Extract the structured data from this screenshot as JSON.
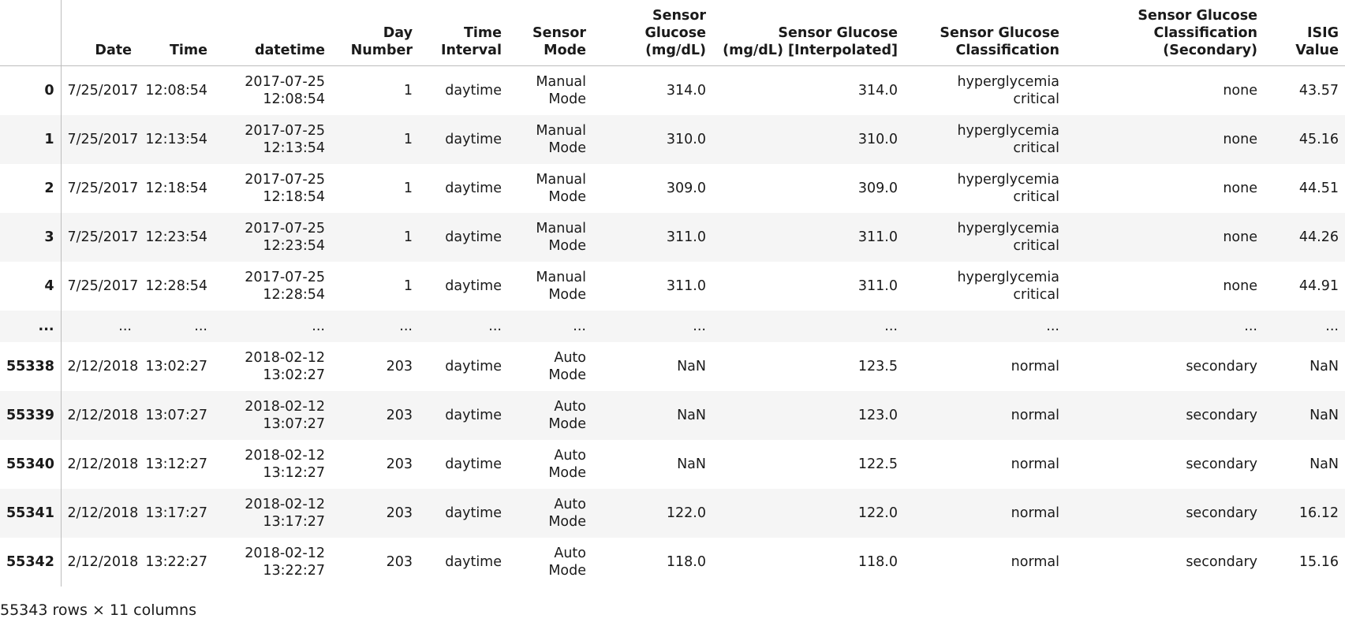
{
  "table": {
    "columns": [
      "Date",
      "Time",
      "datetime",
      "Day Number",
      "Time Interval",
      "Sensor Mode",
      "Sensor Glucose (mg/dL)",
      "Sensor Glucose (mg/dL) [Interpolated]",
      "Sensor Glucose Classification",
      "Sensor Glucose Classification (Secondary)",
      "ISIG Value"
    ],
    "rows": [
      {
        "index": "0",
        "cells": [
          "7/25/2017",
          "12:08:54",
          "2017-07-25 12:08:54",
          "1",
          "daytime",
          "Manual Mode",
          "314.0",
          "314.0",
          "hyperglycemia critical",
          "none",
          "43.57"
        ]
      },
      {
        "index": "1",
        "cells": [
          "7/25/2017",
          "12:13:54",
          "2017-07-25 12:13:54",
          "1",
          "daytime",
          "Manual Mode",
          "310.0",
          "310.0",
          "hyperglycemia critical",
          "none",
          "45.16"
        ]
      },
      {
        "index": "2",
        "cells": [
          "7/25/2017",
          "12:18:54",
          "2017-07-25 12:18:54",
          "1",
          "daytime",
          "Manual Mode",
          "309.0",
          "309.0",
          "hyperglycemia critical",
          "none",
          "44.51"
        ]
      },
      {
        "index": "3",
        "cells": [
          "7/25/2017",
          "12:23:54",
          "2017-07-25 12:23:54",
          "1",
          "daytime",
          "Manual Mode",
          "311.0",
          "311.0",
          "hyperglycemia critical",
          "none",
          "44.26"
        ]
      },
      {
        "index": "4",
        "cells": [
          "7/25/2017",
          "12:28:54",
          "2017-07-25 12:28:54",
          "1",
          "daytime",
          "Manual Mode",
          "311.0",
          "311.0",
          "hyperglycemia critical",
          "none",
          "44.91"
        ]
      },
      {
        "index": "...",
        "cells": [
          "...",
          "...",
          "...",
          "...",
          "...",
          "...",
          "...",
          "...",
          "...",
          "...",
          "..."
        ]
      },
      {
        "index": "55338",
        "cells": [
          "2/12/2018",
          "13:02:27",
          "2018-02-12 13:02:27",
          "203",
          "daytime",
          "Auto Mode",
          "NaN",
          "123.5",
          "normal",
          "secondary",
          "NaN"
        ]
      },
      {
        "index": "55339",
        "cells": [
          "2/12/2018",
          "13:07:27",
          "2018-02-12 13:07:27",
          "203",
          "daytime",
          "Auto Mode",
          "NaN",
          "123.0",
          "normal",
          "secondary",
          "NaN"
        ]
      },
      {
        "index": "55340",
        "cells": [
          "2/12/2018",
          "13:12:27",
          "2018-02-12 13:12:27",
          "203",
          "daytime",
          "Auto Mode",
          "NaN",
          "122.5",
          "normal",
          "secondary",
          "NaN"
        ]
      },
      {
        "index": "55341",
        "cells": [
          "2/12/2018",
          "13:17:27",
          "2018-02-12 13:17:27",
          "203",
          "daytime",
          "Auto Mode",
          "122.0",
          "122.0",
          "normal",
          "secondary",
          "16.12"
        ]
      },
      {
        "index": "55342",
        "cells": [
          "2/12/2018",
          "13:22:27",
          "2018-02-12 13:22:27",
          "203",
          "daytime",
          "Auto Mode",
          "118.0",
          "118.0",
          "normal",
          "secondary",
          "15.16"
        ]
      }
    ]
  },
  "footer": {
    "shape_text": "55343 rows × 11 columns"
  }
}
